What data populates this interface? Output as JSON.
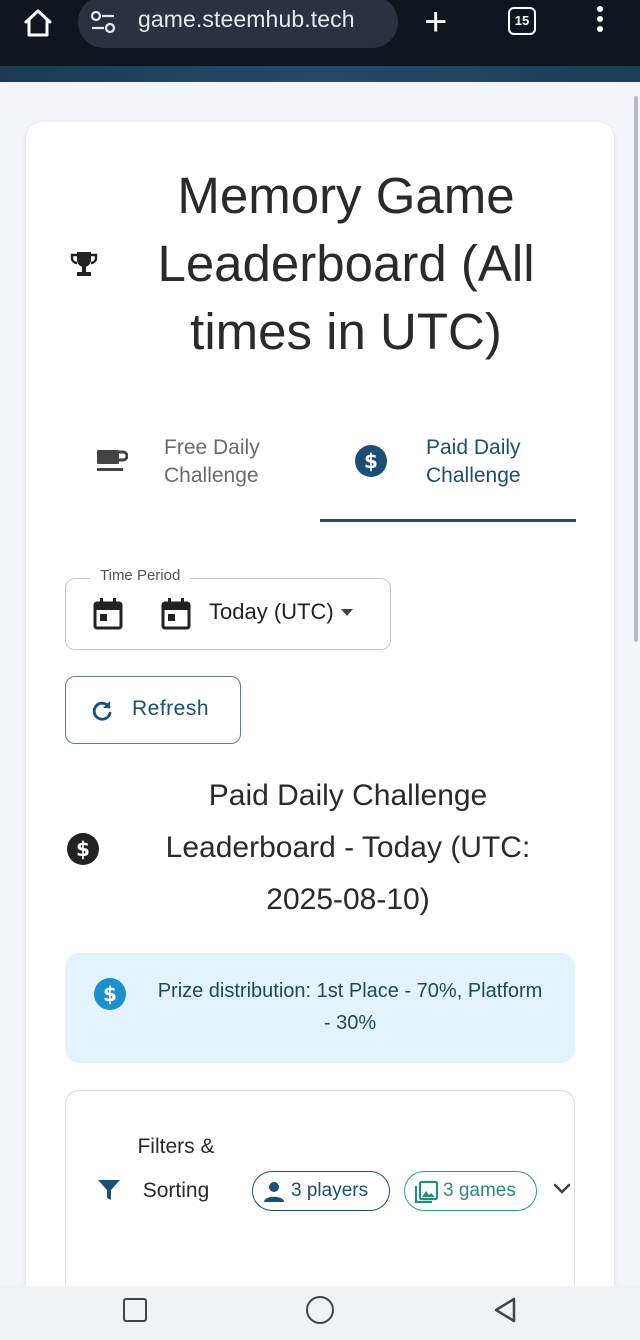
{
  "browser": {
    "url": "game.steemhub.tech",
    "tab_count": "15",
    "icons": [
      "home-icon",
      "site-settings-icon",
      "new-tab-icon",
      "tab-switcher-icon",
      "menu-icon"
    ]
  },
  "page": {
    "title": "Memory Game Leaderboard (All times in UTC)",
    "title_icon": "trophy-icon"
  },
  "tabs": [
    {
      "label": "Free Daily Challenge",
      "icon": "coffee-cup-icon",
      "selected": false
    },
    {
      "label": "Paid Daily Challenge",
      "icon": "dollar-circle-icon",
      "selected": true
    }
  ],
  "time_period": {
    "label": "Time Period",
    "value": "Today (UTC)"
  },
  "refresh_label": "Refresh",
  "leaderboard": {
    "title": "Paid Daily Challenge Leaderboard - Today (UTC: 2025-08-10)"
  },
  "prize": {
    "text": "Prize distribution: 1st Place - 70%, Platform - 30%"
  },
  "filters": {
    "label": "Filters & Sorting",
    "players_chip": "3 players",
    "games_chip": "3 games"
  },
  "colors": {
    "primary": "#1d4e74",
    "accent_teal": "#2a9d8f",
    "info_bg": "#e3f3fb"
  }
}
